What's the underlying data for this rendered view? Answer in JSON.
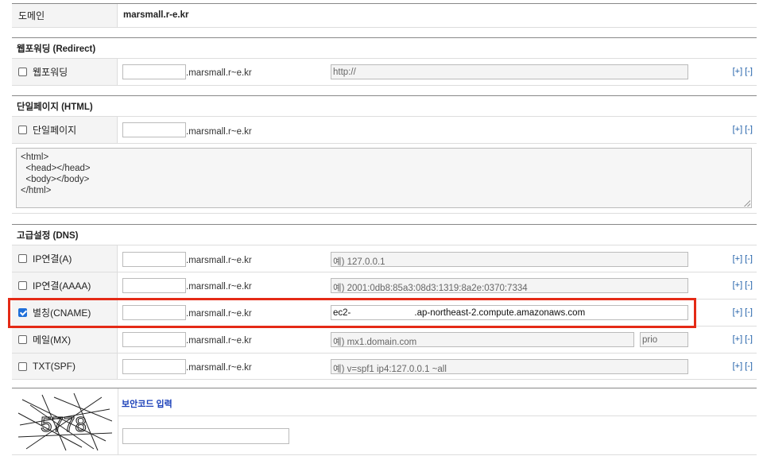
{
  "domain_row": {
    "label": "도메인",
    "value": "marsmall.r-e.kr"
  },
  "suffix": ".marsmall.r~e.kr",
  "plus_minus": "[+] [-]",
  "forwarding": {
    "section": "웹포워딩 (Redirect)",
    "label": "웹포워딩",
    "url_placeholder": "http://"
  },
  "single_page": {
    "section": "단일페이지 (HTML)",
    "label": "단일페이지",
    "html": "<html>\n  <head></head>\n  <body></body>\n</html>"
  },
  "dns": {
    "section": "고급설정 (DNS)",
    "records": [
      {
        "label": "IP연결(A)",
        "checked": false,
        "value": "예) 127.0.0.1"
      },
      {
        "label": "IP연결(AAAA)",
        "checked": false,
        "value": "예) 2001:0db8:85a3:08d3:1319:8a2e:0370:7334"
      },
      {
        "label": "별칭(CNAME)",
        "checked": true,
        "value_prefix": "ec2-",
        "value_suffix": ".ap-northeast-2.compute.amazonaws.com"
      },
      {
        "label": "메일(MX)",
        "checked": false,
        "value": "예) mx1.domain.com",
        "prio_placeholder": "prio"
      },
      {
        "label": "TXT(SPF)",
        "checked": false,
        "value": "예) v=spf1 ip4:127.0.0.1 ~all"
      }
    ]
  },
  "captcha": {
    "label": "보안코드 입력",
    "code": "5778"
  }
}
